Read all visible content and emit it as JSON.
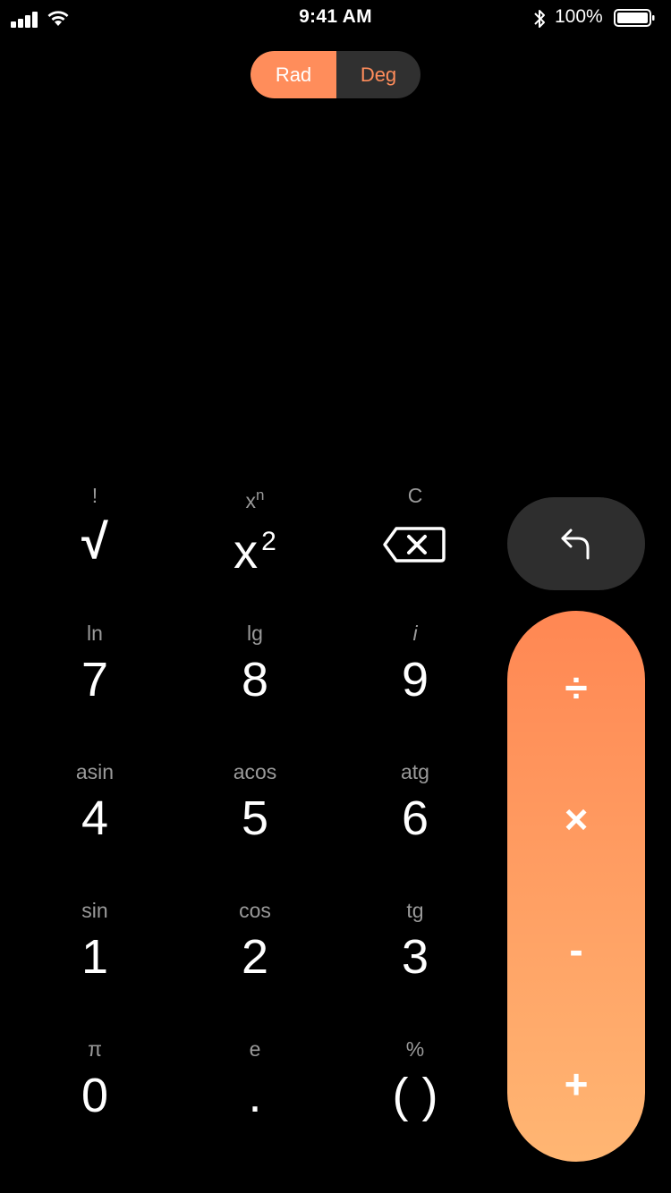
{
  "status_bar": {
    "time": "9:41 AM",
    "battery_percent": "100%",
    "battery_level": 1.0,
    "signal_bars": 4
  },
  "mode": {
    "options": [
      "Rad",
      "Deg"
    ],
    "selected": "Rad",
    "accent_color": "#ff8d5b"
  },
  "keypad": {
    "row1": [
      {
        "secondary": "!",
        "primary": "√"
      },
      {
        "secondary_base": "x",
        "secondary_sup": "n",
        "primary_base": "x",
        "primary_sup": "2"
      },
      {
        "secondary": "C",
        "primary_icon": "backspace-icon"
      }
    ],
    "row2": [
      {
        "secondary": "ln",
        "primary": "7"
      },
      {
        "secondary": "lg",
        "primary": "8"
      },
      {
        "secondary": "i",
        "primary": "9"
      }
    ],
    "row3": [
      {
        "secondary": "asin",
        "primary": "4"
      },
      {
        "secondary": "acos",
        "primary": "5"
      },
      {
        "secondary": "atg",
        "primary": "6"
      }
    ],
    "row4": [
      {
        "secondary": "sin",
        "primary": "1"
      },
      {
        "secondary": "cos",
        "primary": "2"
      },
      {
        "secondary": "tg",
        "primary": "3"
      }
    ],
    "row5": [
      {
        "secondary": "π",
        "primary": "0"
      },
      {
        "secondary": "e",
        "primary": "."
      },
      {
        "secondary": "%",
        "primary": "( )"
      }
    ]
  },
  "operators": {
    "undo_icon": "undo-icon",
    "divide": "÷",
    "multiply": "×",
    "subtract": "-",
    "add": "+",
    "gradient_top": "#ff8753",
    "gradient_bottom": "#ffb673"
  }
}
